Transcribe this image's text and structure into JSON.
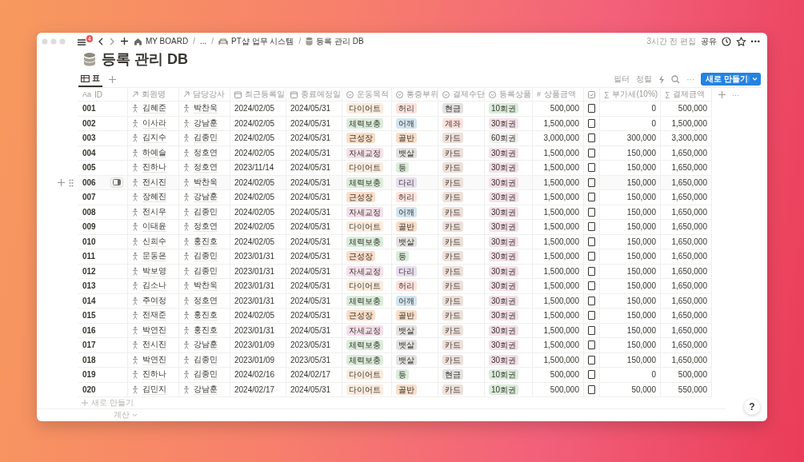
{
  "topbar": {
    "menu_badge": "4",
    "breadcrumbs": [
      {
        "kind": "home",
        "label": "MY BOARD"
      },
      {
        "kind": "separator",
        "label": "/"
      },
      {
        "kind": "ellipsis",
        "label": "..."
      },
      {
        "kind": "separator",
        "label": "/"
      },
      {
        "kind": "page",
        "label": "PT샵 업무 시스템"
      },
      {
        "kind": "separator",
        "label": "/"
      },
      {
        "kind": "database",
        "label": "등록 관리 DB"
      }
    ],
    "edited": "3시간 전 편집",
    "share": "공유",
    "more": "•••"
  },
  "title": "등록 관리 DB",
  "views": [
    {
      "label": "표",
      "selected": true
    }
  ],
  "toolbar": {
    "filter": "필터",
    "sort": "정렬",
    "more": "···",
    "new_button": "새로 만들기"
  },
  "columns": [
    {
      "kind": "title",
      "glyph": "Aa",
      "label": "ID"
    },
    {
      "kind": "relation",
      "label": "회원명"
    },
    {
      "kind": "relation",
      "label": "담당강사"
    },
    {
      "kind": "date",
      "label": "최근등록일"
    },
    {
      "kind": "date",
      "label": "종료예정일"
    },
    {
      "kind": "select",
      "label": "운동목적"
    },
    {
      "kind": "select",
      "label": "통증부위"
    },
    {
      "kind": "select",
      "label": "결제수단"
    },
    {
      "kind": "select",
      "label": "등록상품"
    },
    {
      "kind": "number",
      "glyph": "#",
      "label": "상품금액"
    },
    {
      "kind": "checkbox"
    },
    {
      "kind": "formula",
      "glyph": "∑",
      "label": "부가세(10%)"
    },
    {
      "kind": "formula",
      "glyph": "∑",
      "label": "결제금액"
    }
  ],
  "header_more": "···",
  "rows": [
    {
      "hovered": false,
      "cells": [
        "001",
        "김혜준",
        "박찬욱",
        "2024/02/05",
        "2024/05/31",
        {
          "text": "다이어트",
          "color": "#fbecdd"
        },
        {
          "text": "허리",
          "color": "#ffe2dd"
        },
        {
          "text": "현금",
          "color": "#e3e2e0"
        },
        {
          "text": "10회권",
          "color": "#dbeddb"
        },
        "500,000",
        {
          "checked": false
        },
        "0",
        "500,000"
      ]
    },
    {
      "hovered": false,
      "cells": [
        "002",
        "이사라",
        "강남훈",
        "2024/02/05",
        "2024/05/31",
        {
          "text": "체력보충",
          "color": "#dbeddb"
        },
        {
          "text": "어깨",
          "color": "#d3e5ef"
        },
        {
          "text": "계좌",
          "color": "#ffe2dd"
        },
        {
          "text": "30회권",
          "color": "#f5e0e9"
        },
        "1,500,000",
        {
          "checked": false
        },
        "0",
        "1,500,000"
      ]
    },
    {
      "hovered": false,
      "cells": [
        "003",
        "김지수",
        "김종민",
        "2024/02/05",
        "2024/05/31",
        {
          "text": "근성장",
          "color": "#fadec9"
        },
        {
          "text": "골반",
          "color": "#fadec9"
        },
        {
          "text": "카드",
          "color": "#eee0da"
        },
        {
          "text": "60회권",
          "color": "#f1f1ef"
        },
        "3,000,000",
        {
          "checked": false
        },
        "300,000",
        "3,300,000"
      ]
    },
    {
      "hovered": false,
      "cells": [
        "004",
        "하예슬",
        "정호연",
        "2024/02/05",
        "2024/05/31",
        {
          "text": "자세교정",
          "color": "#f5e0e9"
        },
        {
          "text": "뱃살",
          "color": "#e3e2e0"
        },
        {
          "text": "카드",
          "color": "#eee0da"
        },
        {
          "text": "30회권",
          "color": "#f5e0e9"
        },
        "1,500,000",
        {
          "checked": false
        },
        "150,000",
        "1,650,000"
      ]
    },
    {
      "hovered": false,
      "cells": [
        "005",
        "진하나",
        "정호연",
        "2023/11/14",
        "2024/05/31",
        {
          "text": "다이어트",
          "color": "#fbecdd"
        },
        {
          "text": "등",
          "color": "#dbeddb"
        },
        {
          "text": "카드",
          "color": "#eee0da"
        },
        {
          "text": "30회권",
          "color": "#f5e0e9"
        },
        "1,500,000",
        {
          "checked": false
        },
        "150,000",
        "1,650,000"
      ]
    },
    {
      "hovered": true,
      "cells": [
        "006",
        "전시진",
        "박찬욱",
        "2024/02/05",
        "2024/05/31",
        {
          "text": "체력보충",
          "color": "#dbeddb"
        },
        {
          "text": "다리",
          "color": "#e8deee"
        },
        {
          "text": "카드",
          "color": "#eee0da"
        },
        {
          "text": "30회권",
          "color": "#f5e0e9"
        },
        "1,500,000",
        {
          "checked": false
        },
        "150,000",
        "1,650,000"
      ]
    },
    {
      "hovered": false,
      "cells": [
        "007",
        "장혜진",
        "강남훈",
        "2024/02/05",
        "2024/05/31",
        {
          "text": "근성장",
          "color": "#fadec9"
        },
        {
          "text": "허리",
          "color": "#ffe2dd"
        },
        {
          "text": "카드",
          "color": "#eee0da"
        },
        {
          "text": "30회권",
          "color": "#f5e0e9"
        },
        "1,500,000",
        {
          "checked": false
        },
        "150,000",
        "1,650,000"
      ]
    },
    {
      "hovered": false,
      "cells": [
        "008",
        "전시우",
        "김종민",
        "2024/02/05",
        "2024/05/31",
        {
          "text": "자세교정",
          "color": "#f5e0e9"
        },
        {
          "text": "어깨",
          "color": "#d3e5ef"
        },
        {
          "text": "카드",
          "color": "#eee0da"
        },
        {
          "text": "30회권",
          "color": "#f5e0e9"
        },
        "1,500,000",
        {
          "checked": false
        },
        "150,000",
        "1,650,000"
      ]
    },
    {
      "hovered": false,
      "cells": [
        "009",
        "이태윤",
        "정호연",
        "2024/02/05",
        "2024/05/31",
        {
          "text": "다이어트",
          "color": "#fbecdd"
        },
        {
          "text": "골반",
          "color": "#fadec9"
        },
        {
          "text": "카드",
          "color": "#eee0da"
        },
        {
          "text": "30회권",
          "color": "#f5e0e9"
        },
        "1,500,000",
        {
          "checked": false
        },
        "150,000",
        "1,650,000"
      ]
    },
    {
      "hovered": false,
      "cells": [
        "010",
        "신희수",
        "홍진호",
        "2024/02/05",
        "2024/05/31",
        {
          "text": "체력보충",
          "color": "#dbeddb"
        },
        {
          "text": "뱃살",
          "color": "#e3e2e0"
        },
        {
          "text": "카드",
          "color": "#eee0da"
        },
        {
          "text": "30회권",
          "color": "#f5e0e9"
        },
        "1,500,000",
        {
          "checked": false
        },
        "150,000",
        "1,650,000"
      ]
    },
    {
      "hovered": false,
      "cells": [
        "011",
        "문동은",
        "김종민",
        "2023/01/31",
        "2024/05/31",
        {
          "text": "근성장",
          "color": "#fadec9"
        },
        {
          "text": "등",
          "color": "#dbeddb"
        },
        {
          "text": "카드",
          "color": "#eee0da"
        },
        {
          "text": "30회권",
          "color": "#f5e0e9"
        },
        "1,500,000",
        {
          "checked": false
        },
        "150,000",
        "1,650,000"
      ]
    },
    {
      "hovered": false,
      "cells": [
        "012",
        "박보영",
        "김종민",
        "2023/01/31",
        "2024/05/31",
        {
          "text": "자세교정",
          "color": "#f5e0e9"
        },
        {
          "text": "다리",
          "color": "#e8deee"
        },
        {
          "text": "카드",
          "color": "#eee0da"
        },
        {
          "text": "30회권",
          "color": "#f5e0e9"
        },
        "1,500,000",
        {
          "checked": false
        },
        "150,000",
        "1,650,000"
      ]
    },
    {
      "hovered": false,
      "cells": [
        "013",
        "김소나",
        "박찬욱",
        "2023/01/31",
        "2024/05/31",
        {
          "text": "다이어트",
          "color": "#fbecdd"
        },
        {
          "text": "허리",
          "color": "#ffe2dd"
        },
        {
          "text": "카드",
          "color": "#eee0da"
        },
        {
          "text": "30회권",
          "color": "#f5e0e9"
        },
        "1,500,000",
        {
          "checked": false
        },
        "150,000",
        "1,650,000"
      ]
    },
    {
      "hovered": false,
      "cells": [
        "014",
        "주여정",
        "정호연",
        "2023/01/31",
        "2024/05/31",
        {
          "text": "체력보충",
          "color": "#dbeddb"
        },
        {
          "text": "어깨",
          "color": "#d3e5ef"
        },
        {
          "text": "카드",
          "color": "#eee0da"
        },
        {
          "text": "30회권",
          "color": "#f5e0e9"
        },
        "1,500,000",
        {
          "checked": false
        },
        "150,000",
        "1,650,000"
      ]
    },
    {
      "hovered": false,
      "cells": [
        "015",
        "전재준",
        "홍진호",
        "2024/02/05",
        "2024/05/31",
        {
          "text": "근성장",
          "color": "#fadec9"
        },
        {
          "text": "골반",
          "color": "#fadec9"
        },
        {
          "text": "카드",
          "color": "#eee0da"
        },
        {
          "text": "30회권",
          "color": "#f5e0e9"
        },
        "1,500,000",
        {
          "checked": false
        },
        "150,000",
        "1,650,000"
      ]
    },
    {
      "hovered": false,
      "cells": [
        "016",
        "박연진",
        "홍진호",
        "2023/01/31",
        "2024/05/31",
        {
          "text": "자세교정",
          "color": "#f5e0e9"
        },
        {
          "text": "뱃살",
          "color": "#e3e2e0"
        },
        {
          "text": "카드",
          "color": "#eee0da"
        },
        {
          "text": "30회권",
          "color": "#f5e0e9"
        },
        "1,500,000",
        {
          "checked": false
        },
        "150,000",
        "1,650,000"
      ]
    },
    {
      "hovered": false,
      "cells": [
        "017",
        "전시진",
        "강남훈",
        "2023/01/09",
        "2023/05/31",
        {
          "text": "체력보충",
          "color": "#dbeddb"
        },
        {
          "text": "뱃살",
          "color": "#e3e2e0"
        },
        {
          "text": "카드",
          "color": "#eee0da"
        },
        {
          "text": "30회권",
          "color": "#f5e0e9"
        },
        "1,500,000",
        {
          "checked": false
        },
        "150,000",
        "1,650,000"
      ]
    },
    {
      "hovered": false,
      "cells": [
        "018",
        "박연진",
        "김종민",
        "2023/01/09",
        "2023/05/31",
        {
          "text": "체력보충",
          "color": "#dbeddb"
        },
        {
          "text": "뱃살",
          "color": "#e3e2e0"
        },
        {
          "text": "카드",
          "color": "#eee0da"
        },
        {
          "text": "30회권",
          "color": "#f5e0e9"
        },
        "1,500,000",
        {
          "checked": false
        },
        "150,000",
        "1,650,000"
      ]
    },
    {
      "hovered": false,
      "cells": [
        "019",
        "진하나",
        "김종민",
        "2024/02/16",
        "2024/02/17",
        {
          "text": "다이어트",
          "color": "#fbecdd"
        },
        {
          "text": "등",
          "color": "#dbeddb"
        },
        {
          "text": "현금",
          "color": "#e3e2e0"
        },
        {
          "text": "10회권",
          "color": "#dbeddb"
        },
        "500,000",
        {
          "checked": false
        },
        "0",
        "500,000"
      ]
    },
    {
      "hovered": false,
      "cells": [
        "020",
        "김민지",
        "강남훈",
        "2024/02/17",
        "2024/05/31",
        {
          "text": "다이어트",
          "color": "#fbecdd"
        },
        {
          "text": "골반",
          "color": "#fadec9"
        },
        {
          "text": "카드",
          "color": "#eee0da"
        },
        {
          "text": "10회권",
          "color": "#dbeddb"
        },
        "500,000",
        {
          "checked": false
        },
        "50,000",
        "550,000"
      ]
    }
  ],
  "add_row": "새로 만들기",
  "calculate": "계산",
  "help": "?"
}
